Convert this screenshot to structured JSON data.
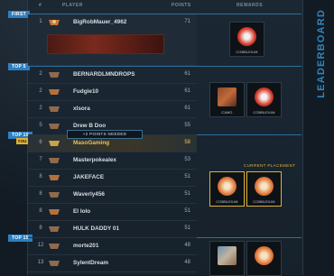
{
  "headers": {
    "rank": "#",
    "player": "PLAYER",
    "points": "POINTS",
    "rewards": "REWARDS"
  },
  "title": "LEADERBOARD",
  "tiers": [
    {
      "label": "FIRST"
    },
    {
      "label": "TOP 5"
    },
    {
      "label": "TOP 10"
    },
    {
      "label": "TOP 15"
    }
  ],
  "you_label": "YOU",
  "tooltip": "+2 POINTS NEEDED",
  "current_placement": "CURRENT PLACEMENT",
  "rows": [
    {
      "rank": "1",
      "name": "BigRobMauer_4962",
      "points": "71"
    },
    {
      "rank": "2",
      "name": "BERNARDLMNDROPS",
      "points": "61"
    },
    {
      "rank": "2",
      "name": "Fudgie10",
      "points": "61"
    },
    {
      "rank": "2",
      "name": "xlsora",
      "points": "61"
    },
    {
      "rank": "5",
      "name": "Drew B Doo",
      "points": "55"
    },
    {
      "rank": "6",
      "name": "MasoGaming",
      "points": "58"
    },
    {
      "rank": "7",
      "name": "Masterpokealex",
      "points": "53"
    },
    {
      "rank": "8",
      "name": "JAKEFACE",
      "points": "51"
    },
    {
      "rank": "8",
      "name": "Waverly456",
      "points": "51"
    },
    {
      "rank": "8",
      "name": "El lolo",
      "points": "51"
    },
    {
      "rank": "8",
      "name": "HULK DADDY 01",
      "points": "51"
    },
    {
      "rank": "12",
      "name": "morte201",
      "points": "48"
    },
    {
      "rank": "13",
      "name": "SylentDream",
      "points": "48"
    }
  ],
  "rewards": {
    "first": [
      {
        "caption": "COBBLEIUM"
      }
    ],
    "top5": [
      {
        "caption": "CAMO"
      },
      {
        "caption": "COBBLEIUM"
      }
    ],
    "top10": [
      {
        "caption": "COBBLEIUM"
      },
      {
        "caption": "COBBLEIUM"
      }
    ],
    "top15": [
      {
        "caption": ""
      },
      {
        "caption": ""
      }
    ]
  },
  "colors": {
    "accent": "#2f86bf",
    "highlight": "#e7c45a",
    "you": "#e0b02f"
  }
}
